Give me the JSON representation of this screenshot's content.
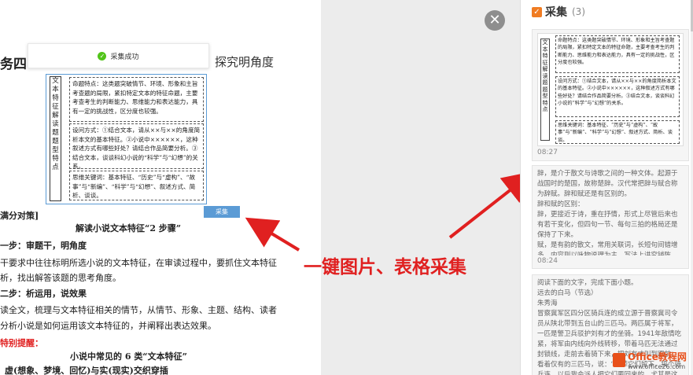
{
  "toast": {
    "message": "采集成功"
  },
  "collect_button": {
    "label": "采集"
  },
  "annotation": {
    "text": "一键图片、表格采集"
  },
  "document": {
    "heading_fragment": "务四",
    "heading_right": "探究明角度",
    "section_label": "满分对策]",
    "title1": "解读小说文本特征“2 步骤”",
    "step1": "一步：审题干，明角度",
    "para1": "干要求中往往标明所选小说的文本特征，在审读过程中，要抓住文本特征",
    "para1b": "析，找出解答该题的思考角度。",
    "step2": "二步：析运用，说效果",
    "para2": "读全文，梳理与文本特征相关的情节，从情节、形象、主题、结构、读者",
    "para2b": "分析小说是如何运用该文本特征的，并阐释出表达效果。",
    "note": "特别提醒：",
    "title2": "小说中常见的 6 类“文本特征”",
    "item1": "虚(想象、梦境、回忆)与实(现实)交织穿插"
  },
  "diagram": {
    "vertical_label": "文本特征解读题题型特点",
    "box1": "命题特点：这类题突破情节、环境、形象和主旨考查题的局限，紧扣特定文本的特征命题，主要考查考生的判断能力、思维能力和表达能力，具有一定的挑战性，区分度也较强。",
    "box2": "设问方式：①结合文本，请从××与××的角度简析本文的基本特征。②小说中××××××，这种叙述方式有哪些好处？请结合作品简要分析。③结合文本，谈谈科幻小说的“科学”与“幻想”的关系。",
    "box3": "思维关键词：基本特征、“历史”与“虚构”、“故事”与“新编”、“科学”与“幻想”、叙述方式、简析、谈谈。"
  },
  "panel": {
    "title": "采集",
    "count": "(3)",
    "cards": [
      {
        "time": "08:27"
      },
      {
        "text": "辞，是介于散文与诗歌之间的一种文体。起源于战国时的楚国，故称楚辞。汉代常把辞与赋合称为辞赋。辞和赋还是有区别的。\n辞和赋的区别：\n辞，更接近于诗，重在抒情，形式上尽管后来也有若干变化，但四句一节、每句三拍的格局还是保持了下来。\n赋，是有韵的散文，常用关联词，长短句间错增多，内容则以咏物说理为主，写法上讲究铺陈，即所谓“以事形为本，以义正为助”。",
        "time": "08:24"
      },
      {
        "text": "阅读下面的文字，完成下面小题。\n远去的白马（节选）\n朱秀海\n冒察冀军区四分区骑兵连的成立源于晋察冀司令员从陕北带到五台山的三匹马。两匹属于将军，一匹是警卫兵驳护刘有才的坐骑。1941年敌情吃紧，将军由内线向外线转移，带着马匹无法通过封锁线，走前去着骑下来，把刘有才叫到跟前：看着仅有的三匹马，说：“你带它们留下，搞个骑兵连，以后我会派人把它们要回来的。尤其是这匹大白马……”"
      }
    ]
  },
  "watermark": {
    "brand": "Office教程网",
    "url": "www.office26.com"
  }
}
